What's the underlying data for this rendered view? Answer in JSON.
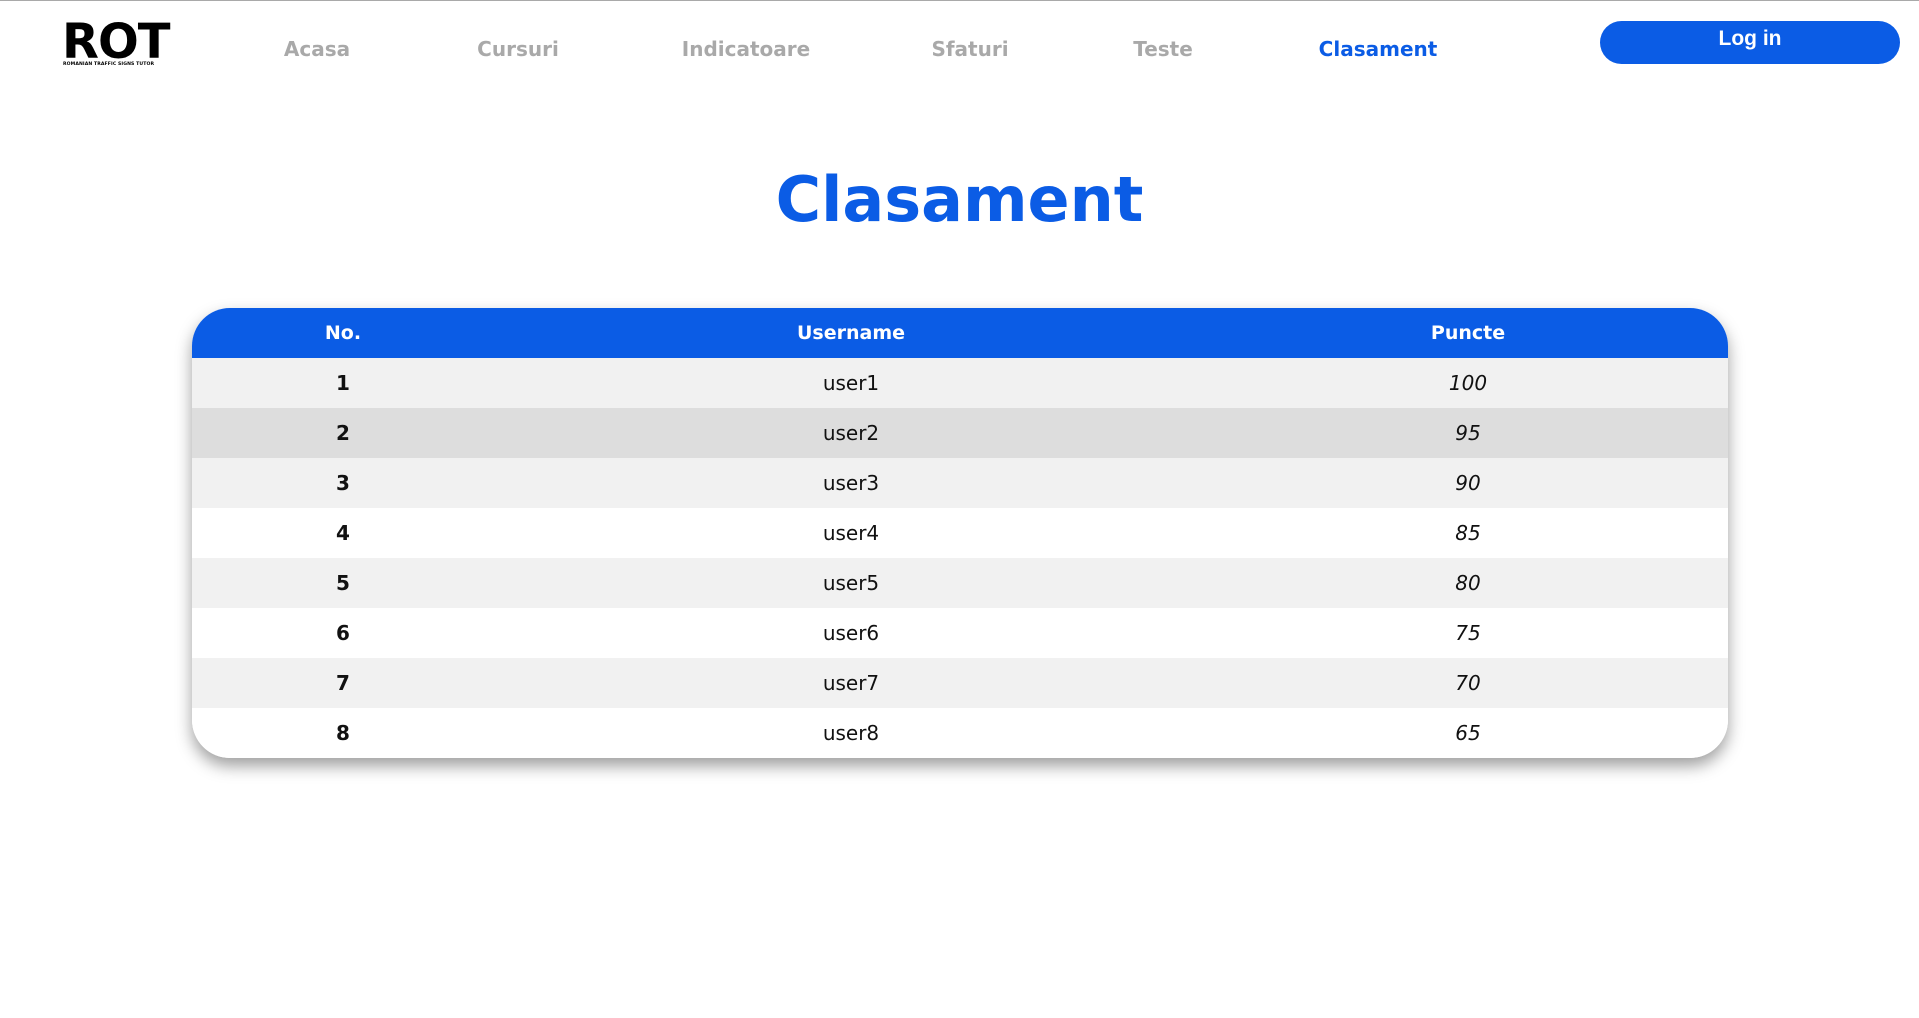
{
  "logo": {
    "word": "ROT",
    "tagline": "ROMANIAN TRAFFIC SIGNS TUTOR"
  },
  "nav": {
    "items": [
      {
        "label": "Acasa",
        "active": false
      },
      {
        "label": "Cursuri",
        "active": false
      },
      {
        "label": "Indicatoare",
        "active": false
      },
      {
        "label": "Sfaturi",
        "active": false
      },
      {
        "label": "Teste",
        "active": false
      },
      {
        "label": "Clasament",
        "active": true
      }
    ],
    "login_label": "Log in"
  },
  "colors": {
    "accent": "#0b5ce5",
    "nav_inactive": "#a9a9a9",
    "row_odd": "#f1f1f1",
    "row_even": "#ffffff",
    "row_hover": "#dddddd"
  },
  "page": {
    "title": "Clasament"
  },
  "leaderboard": {
    "headers": {
      "no": "No.",
      "username": "Username",
      "points": "Puncte"
    },
    "rows": [
      {
        "no": "1",
        "username": "user1",
        "points": "100"
      },
      {
        "no": "2",
        "username": "user2",
        "points": "95"
      },
      {
        "no": "3",
        "username": "user3",
        "points": "90"
      },
      {
        "no": "4",
        "username": "user4",
        "points": "85"
      },
      {
        "no": "5",
        "username": "user5",
        "points": "80"
      },
      {
        "no": "6",
        "username": "user6",
        "points": "75"
      },
      {
        "no": "7",
        "username": "user7",
        "points": "70"
      },
      {
        "no": "8",
        "username": "user8",
        "points": "65"
      }
    ],
    "hovered_row": 2
  }
}
